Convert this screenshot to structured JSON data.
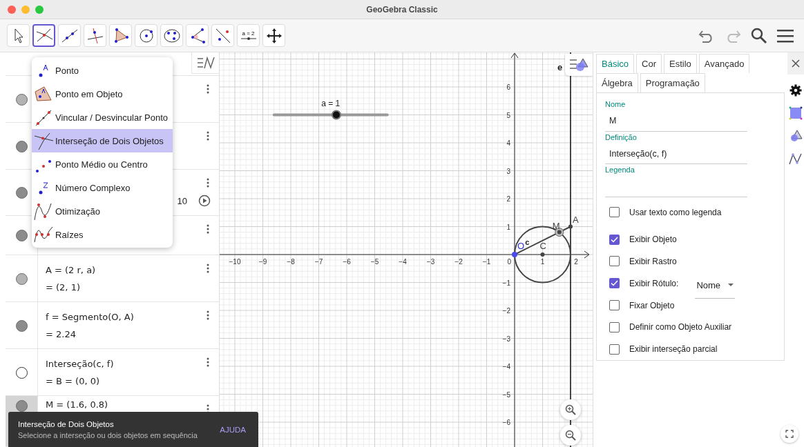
{
  "window": {
    "title": "GeoGebra Classic"
  },
  "toolbar": {
    "tools": [
      {
        "selected": false
      },
      {
        "selected": true
      },
      {
        "selected": false
      },
      {
        "selected": false
      },
      {
        "selected": false
      },
      {
        "selected": false
      },
      {
        "selected": false
      },
      {
        "selected": false
      },
      {
        "selected": false
      },
      {
        "selected": false,
        "label": "a = 2"
      },
      {
        "selected": false
      }
    ]
  },
  "algebra": {
    "rows": [
      {
        "kind": "point",
        "visible": true,
        "color": "#b3b3b3",
        "selected": false
      },
      {
        "kind": "point",
        "visible": true,
        "color": "#8c8c8c",
        "selected": false
      },
      {
        "kind": "slider",
        "visible": true,
        "color": "#8c8c8c",
        "selected": false,
        "max": "10"
      },
      {
        "kind": "equation",
        "visible": true,
        "color": "#8c8c8c",
        "selected": false
      },
      {
        "kind": "point",
        "visible": true,
        "color": "#b3b3b3",
        "selected": false,
        "lines": [
          "A = (2 r, a)",
          "= (2, 1)"
        ]
      },
      {
        "kind": "point",
        "visible": true,
        "color": "#8c8c8c",
        "selected": false,
        "lines": [
          "f = Segmento(O, A)",
          "= 2.24"
        ]
      },
      {
        "kind": "point",
        "visible": false,
        "color": "#ffffff",
        "selected": false,
        "lines": [
          "Interseção(c, f)",
          "= B = (0, 0)"
        ]
      },
      {
        "kind": "point",
        "visible": true,
        "color": "#8c8c8c",
        "selected": true,
        "lines": [
          "M = (1.6, 0.8)"
        ]
      }
    ]
  },
  "tool_menu": {
    "items": [
      {
        "label": "Ponto",
        "selected": false
      },
      {
        "label": "Ponto em Objeto",
        "selected": false
      },
      {
        "label": "Vincular / Desvincular Ponto",
        "selected": false
      },
      {
        "label": "Interseção de Dois Objetos",
        "selected": true
      },
      {
        "label": "Ponto Médio ou Centro",
        "selected": false
      },
      {
        "label": "Número Complexo",
        "selected": false
      },
      {
        "label": "Otimização",
        "selected": false
      },
      {
        "label": "Raízes",
        "selected": false
      }
    ]
  },
  "graphics": {
    "slider": {
      "label": "a = 1",
      "level": 0.55
    },
    "x_ticks": [
      "−10",
      "−9",
      "−8",
      "−7",
      "−6",
      "−5",
      "−4",
      "−3",
      "−2",
      "−1",
      "1",
      "2"
    ],
    "y_ticks": [
      "6",
      "5",
      "4",
      "3",
      "2",
      "1",
      "−1",
      "−2",
      "−3",
      "−4",
      "−5",
      "−6"
    ],
    "origin_label": "0",
    "object_labels": [
      "O",
      "c",
      "C",
      "M",
      "A",
      "e"
    ]
  },
  "properties": {
    "tabs": [
      {
        "label": "Básico",
        "selected": true
      },
      {
        "label": "Cor",
        "selected": false
      },
      {
        "label": "Estilo",
        "selected": false
      },
      {
        "label": "Avançado",
        "selected": false
      },
      {
        "label": "Álgebra",
        "selected": false
      },
      {
        "label": "Programação",
        "selected": false
      }
    ],
    "fields": [
      {
        "label": "Nome",
        "value": "M"
      },
      {
        "label": "Definição",
        "value": "Interseção(c, f)"
      },
      {
        "label": "Legenda"
      }
    ],
    "options": [
      {
        "kind": "checkbox",
        "label": "Usar texto como legenda",
        "checked": false
      },
      {
        "kind": "checkbox",
        "label": "Exibir Objeto",
        "checked": true
      },
      {
        "kind": "checkbox",
        "label": "Exibir Rastro",
        "checked": false
      },
      {
        "kind": "dropdown",
        "label": "Exibir Rótulo:",
        "checked": true,
        "value": "Nome"
      },
      {
        "kind": "checkbox",
        "label": "Fixar Objeto",
        "checked": false
      },
      {
        "kind": "checkbox",
        "label": "Definir como Objeto Auxiliar",
        "checked": false
      },
      {
        "kind": "checkbox",
        "label": "Exibir interseção parcial",
        "checked": false
      }
    ]
  },
  "toast": {
    "title": "Interseção de Dois Objetos",
    "message": "Selecione a interseção ou dois objetos em sequência",
    "action": "AJUDA"
  }
}
